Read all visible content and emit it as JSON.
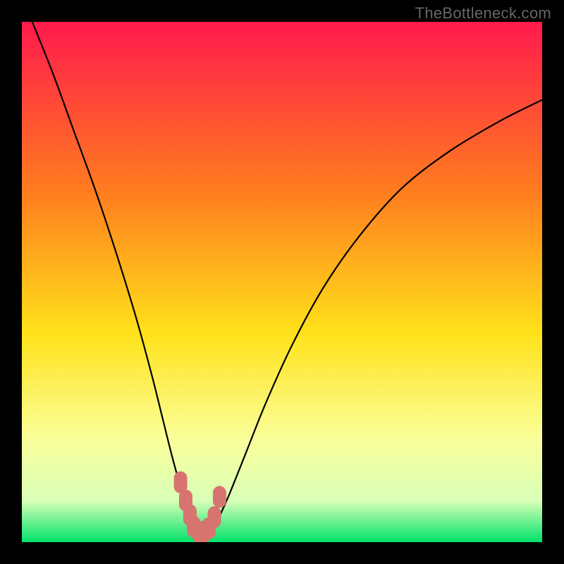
{
  "watermark": "TheBottleneck.com",
  "colors": {
    "outer_bg": "#000000",
    "gradient_top": "#ff1a4d",
    "gradient_mid1": "#ff7e1e",
    "gradient_mid2": "#ffe21a",
    "gradient_mid3": "#faff99",
    "gradient_mid4": "#d9ffb8",
    "gradient_bottom": "#00e26a",
    "curve": "#000000",
    "marker": "#d8746f"
  },
  "chart_data": {
    "type": "line",
    "title": "",
    "xlabel": "",
    "ylabel": "",
    "xlim": [
      0,
      100
    ],
    "ylim": [
      0,
      100
    ],
    "series": [
      {
        "name": "bottleneck-curve",
        "x": [
          2,
          6,
          10,
          14,
          18,
          22,
          25,
          27,
          29,
          31,
          32.5,
          34,
          35,
          36.5,
          38,
          40,
          43,
          47,
          52,
          58,
          65,
          73,
          82,
          92,
          100
        ],
        "y": [
          100,
          90,
          79,
          68,
          56,
          43,
          32,
          24,
          16,
          9,
          5,
          2,
          1.2,
          2,
          5,
          9.5,
          17,
          27,
          38,
          49,
          59,
          68,
          75,
          81,
          85
        ]
      }
    ],
    "markers": {
      "name": "highlight-segment",
      "shape": "rounded-capsule",
      "x": [
        30.5,
        31.5,
        32.3,
        33.0,
        34.0,
        35.0,
        36.0,
        37.0,
        38.0
      ],
      "y": [
        11.5,
        8.0,
        5.2,
        3.0,
        2.0,
        2.0,
        2.7,
        4.8,
        8.7
      ]
    }
  }
}
